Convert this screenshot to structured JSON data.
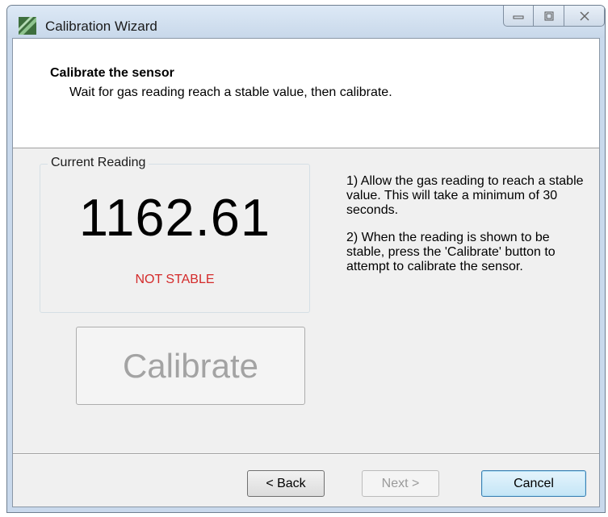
{
  "window": {
    "title": "Calibration Wizard",
    "app_icon": "wizard-app-icon",
    "caption_buttons": {
      "minimize_icon": "minimize-icon",
      "maximize_icon": "maximize-icon",
      "close_icon": "close-icon"
    }
  },
  "header": {
    "title": "Calibrate the sensor",
    "subtitle": "Wait for gas reading reach a stable value, then calibrate."
  },
  "reading": {
    "group_label": "Current Reading",
    "value": "1162.61",
    "status": "NOT STABLE",
    "status_color": "#d42a2a"
  },
  "calibrate_button": "Calibrate",
  "instructions": [
    "1) Allow the gas reading to reach a stable value. This will take a minimum of 30 seconds.",
    "2) When the reading is shown to be stable, press the 'Calibrate' button to attempt to calibrate the sensor."
  ],
  "footer": {
    "back": "< Back",
    "next": "Next >",
    "cancel": "Cancel"
  }
}
